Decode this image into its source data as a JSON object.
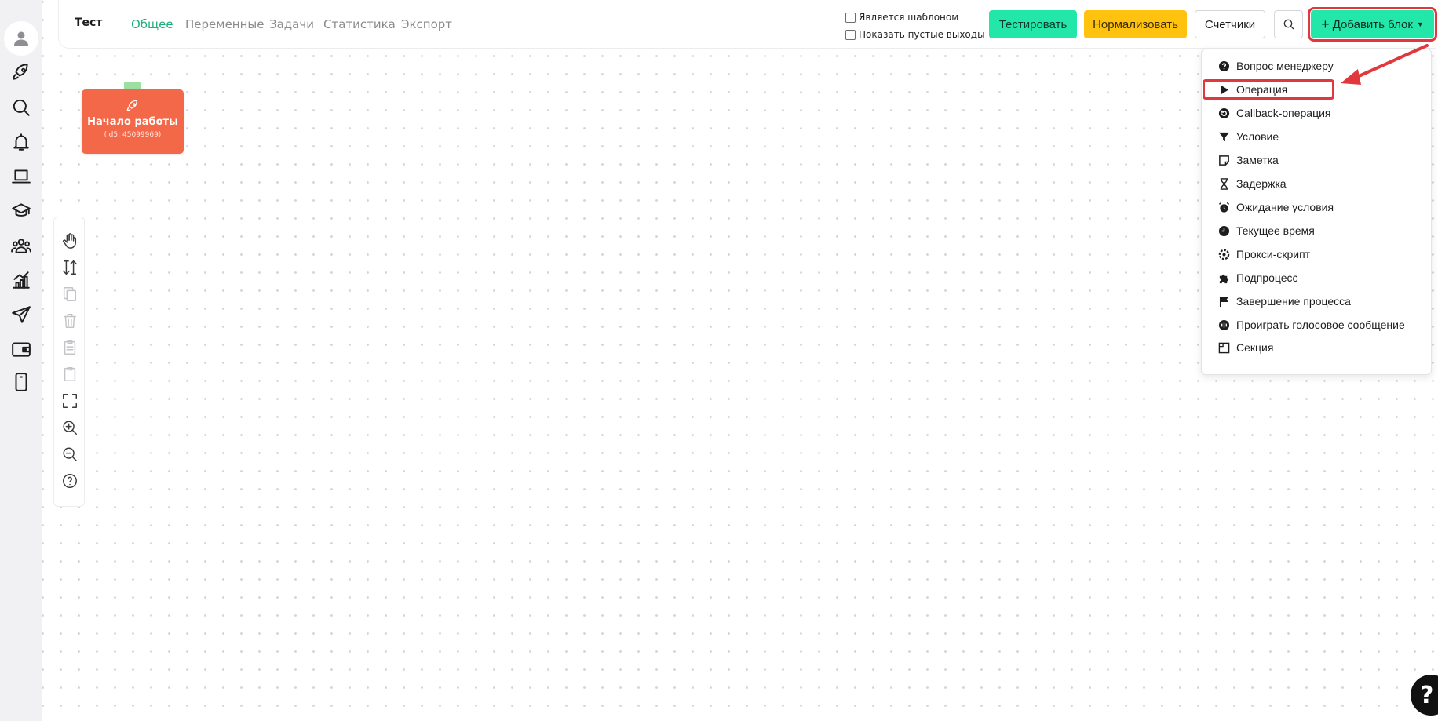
{
  "header": {
    "title": "Тест",
    "tabs": [
      "Общее",
      "Переменные",
      "Задачи",
      "Статистика",
      "Экспорт"
    ],
    "checkboxes": [
      "Является шаблоном",
      "Показать пустые выходы"
    ],
    "buttons": {
      "test": "Тестировать",
      "normalize": "Нормализовать",
      "counters": "Счетчики",
      "add_block": "Добавить блок"
    }
  },
  "start_node": {
    "title": "Начало работы",
    "id_text": "(id5: 45099969)"
  },
  "add_block_menu": {
    "items": [
      {
        "label": "Вопрос менеджеру",
        "icon": "question-circle-icon"
      },
      {
        "label": "Операция",
        "icon": "play-icon"
      },
      {
        "label": "Callback-операция",
        "icon": "callback-icon"
      },
      {
        "label": "Условие",
        "icon": "filter-icon"
      },
      {
        "label": "Заметка",
        "icon": "note-icon"
      },
      {
        "label": "Задержка",
        "icon": "hourglass-icon"
      },
      {
        "label": "Ожидание условия",
        "icon": "alarm-clock-icon"
      },
      {
        "label": "Текущее время",
        "icon": "clock-icon"
      },
      {
        "label": "Прокси-скрипт",
        "icon": "proxy-icon"
      },
      {
        "label": "Подпроцесс",
        "icon": "puzzle-icon"
      },
      {
        "label": "Завершение процесса",
        "icon": "flag-icon"
      },
      {
        "label": "Проиграть голосовое сообщение",
        "icon": "voice-icon"
      },
      {
        "label": "Секция",
        "icon": "section-icon"
      }
    ],
    "highlighted": "Операция"
  },
  "help": {
    "label": "?"
  },
  "colors": {
    "accent_green": "#22e7a8",
    "accent_yellow": "#ffc20e",
    "start_node": "#f4684a",
    "highlight_red": "#e0383c",
    "active_tab": "#1fae80"
  }
}
